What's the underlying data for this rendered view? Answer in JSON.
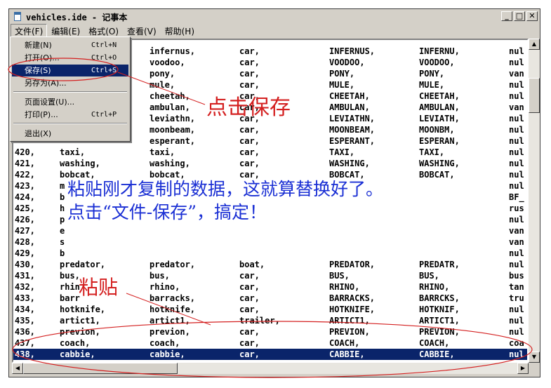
{
  "window": {
    "title": "vehicles.ide - 记事本",
    "minimize_glyph": "_",
    "maximize_glyph": "□",
    "close_glyph": "✕"
  },
  "menubar": [
    {
      "label": "文件(F)"
    },
    {
      "label": "编辑(E)"
    },
    {
      "label": "格式(O)"
    },
    {
      "label": "查看(V)"
    },
    {
      "label": "帮助(H)"
    }
  ],
  "file_menu": {
    "items": [
      {
        "label": "新建(N)",
        "shortcut": "Ctrl+N"
      },
      {
        "label": "打开(O)...",
        "shortcut": "Ctrl+O"
      },
      {
        "label": "保存(S)",
        "shortcut": "Ctrl+S",
        "highlighted": true
      },
      {
        "label": "另存为(A)...",
        "shortcut": ""
      },
      {
        "label": "页面设置(U)...",
        "shortcut": ""
      },
      {
        "label": "打印(P)...",
        "shortcut": "Ctrl+P"
      },
      {
        "label": "退出(X)",
        "shortcut": ""
      }
    ]
  },
  "editor": {
    "rows": [
      [
        "",
        "",
        "infernus,",
        "car,",
        "INFERNUS,",
        "INFERNU,",
        "nul"
      ],
      [
        "",
        "",
        "voodoo,",
        "car,",
        "VOODOO,",
        "VOODOO,",
        "nul"
      ],
      [
        "",
        "",
        "pony,",
        "car,",
        "PONY,",
        "PONY,",
        "van"
      ],
      [
        "",
        "",
        "mule,",
        "car,",
        "MULE,",
        "MULE,",
        "nul"
      ],
      [
        "",
        "",
        "cheetah,",
        "car,",
        "CHEETAH,",
        "CHEETAH,",
        "nul"
      ],
      [
        "",
        "",
        "ambulan,",
        "car,",
        "AMBULAN,",
        "AMBULAN,",
        "van"
      ],
      [
        "",
        "",
        "leviathn,",
        "car,",
        "LEVIATHN,",
        "LEVIATH,",
        "nul"
      ],
      [
        "",
        "",
        "moonbeam,",
        "car,",
        "MOONBEAM,",
        "MOONBM,",
        "nul"
      ],
      [
        "",
        "",
        "esperant,",
        "car,",
        "ESPERANT,",
        "ESPERAN,",
        "nul"
      ],
      [
        "420,",
        "taxi,",
        "taxi,",
        "car,",
        "TAXI,",
        "TAXI,",
        "nul"
      ],
      [
        "421,",
        "washing,",
        "washing,",
        "car,",
        "WASHING,",
        "WASHING,",
        "nul"
      ],
      [
        "422,",
        "bobcat,",
        "bobcat,",
        "car,",
        "BOBCAT,",
        "BOBCAT,",
        "nul"
      ],
      [
        "423,",
        "m",
        "",
        "",
        "",
        "",
        "nul"
      ],
      [
        "424,",
        "b",
        "",
        "",
        "",
        "",
        "BF_"
      ],
      [
        "425,",
        "h",
        "",
        "",
        "",
        "",
        "rus"
      ],
      [
        "426,",
        "p",
        "",
        "",
        "",
        "",
        "nul"
      ],
      [
        "427,",
        "e",
        "",
        "",
        "",
        "",
        "van"
      ],
      [
        "428,",
        "s",
        "",
        "",
        "",
        "",
        "van"
      ],
      [
        "429,",
        "b",
        "",
        "",
        "",
        "",
        "nul"
      ],
      [
        "430,",
        "predator,",
        "predator,",
        "boat,",
        "PREDATOR,",
        "PREDATR,",
        "nul"
      ],
      [
        "431,",
        "bus,",
        "bus,",
        "car,",
        "BUS,",
        "BUS,",
        "bus"
      ],
      [
        "432,",
        "rhin",
        "rhino,",
        "car,",
        "RHINO,",
        "RHINO,",
        "tan"
      ],
      [
        "433,",
        "barr",
        "barracks,",
        "car,",
        "BARRACKS,",
        "BARRCKS,",
        "tru"
      ],
      [
        "434,",
        "hotknife,",
        "hotknife,",
        "car,",
        "HOTKNIFE,",
        "HOTKNIF,",
        "nul"
      ],
      [
        "435,",
        "artict1,",
        "artict1,",
        "trailer,",
        "ARTICT1,",
        "ARTICT1,",
        "nul"
      ],
      [
        "436,",
        "previon,",
        "previon,",
        "car,",
        "PREVION,",
        "PREVION,",
        "nul"
      ],
      [
        "437,",
        "coach,",
        "coach,",
        "car,",
        "COACH,",
        "COACH,",
        "coa"
      ],
      [
        "438,",
        "cabbie,",
        "cabbie,",
        "car,",
        "CABBIE,",
        "CABBIE,",
        "nul"
      ]
    ],
    "selected_row": 27
  },
  "annotations": {
    "click_save": "点击保存",
    "paste_line1": "粘贴刚才复制的数据，这就算替换好了。",
    "paste_line2": "点击“文件-保存”，搞定！",
    "paste": "粘贴"
  },
  "colors": {
    "annotation_red": "#d42020",
    "annotation_blue": "#1a2fd4",
    "selection": "#0a246a"
  }
}
